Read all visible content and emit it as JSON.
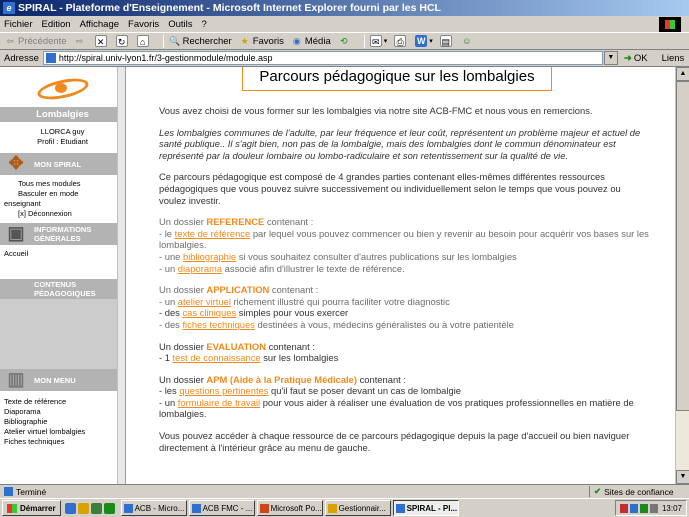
{
  "window": {
    "title": "SPIRAL - Plateforme d'Enseignement - Microsoft Internet Explorer fourni par les HCL"
  },
  "menu": [
    "Fichier",
    "Edition",
    "Affichage",
    "Favoris",
    "Outils",
    "?"
  ],
  "toolbar": {
    "back": "Précédente",
    "search": "Rechercher",
    "favorites": "Favoris",
    "media": "Média"
  },
  "address": {
    "label": "Adresse",
    "url": "http://spiral.univ-lyon1.fr/3-gestionmodule/module.asp",
    "go": "OK",
    "links": "Liens"
  },
  "sidebar": {
    "module_title": "Lombalgies",
    "user_name": "LLORCA guy",
    "user_profile": "Profil : Etudiant",
    "sections": {
      "mon_spiral": "MON SPIRAL",
      "informations": "INFORMATIONS GÉNÉRALES",
      "contenus": "CONTENUS PÉDAGOGIQUES",
      "mon_menu": "MON MENU"
    },
    "mon_spiral_links": [
      "Tous mes modules",
      "Basculer en mode",
      "enseignant",
      "[x] Déconnexion"
    ],
    "info_links": [
      "Accueil"
    ],
    "menu_links": [
      "Texte de référence",
      "Diaporama",
      "Bibliographie",
      "Atelier virtuel lombalgies",
      "Fiches techniques"
    ]
  },
  "page": {
    "heading": "Parcours pédagogique sur les lombalgies",
    "intro": "Vous avez choisi de vous former sur les lombalgies via notre site ACB-FMC et nous vous en remercions.",
    "quote": "Les lombalgies communes de l'adulte, par leur fréquence et leur coût, représentent un problème majeur et actuel de santé publique.. Il s'agit bien, non pas de la lombalgie, mais des lombalgies dont le commun dénominateur est représenté par la douleur lombaire ou lombo-radiculaire et son retentissement sur la qualité de vie.",
    "description": "Ce parcours pédagogique est composé de 4 grandes parties contenant elles-mêmes différentes ressources pédagogiques que vous pouvez suivre successivement ou individuellement selon le temps que vous pouvez ou voulez investir.",
    "reference": {
      "prefix": "Un dossier ",
      "keyword": "REFERENCE",
      "suffix": " contenant :",
      "item1_pre": "- le ",
      "item1_link": "texte de référence",
      "item1_post": " par lequel vous pouvez commencer ou bien y revenir au besoin pour acquérir vos bases sur les lombalgies.",
      "item2_pre": "- une ",
      "item2_link": "bibliographie",
      "item2_post": " si vous souhaitez consulter d'autres publications sur les lombalgies",
      "item3_pre": "- un ",
      "item3_link": "diaporama",
      "item3_post": " associé afin d'illustrer le texte de référence."
    },
    "application": {
      "prefix": "Un dossier ",
      "keyword": "APPLICATION",
      "suffix": " contenant :",
      "item1_pre": "- un ",
      "item1_link": "atelier virtuel",
      "item1_post": " richement illustré qui pourra faciliter votre diagnostic",
      "item2_pre": "- des ",
      "item2_link": "cas cliniques",
      "item2_post": " simples pour vous exercer",
      "item3_pre": "- des ",
      "item3_link": "fiches techniques",
      "item3_post": " destinées à vous, médecins généralistes ou à votre patientèle"
    },
    "evaluation": {
      "prefix": "Un dossier ",
      "keyword": "EVALUATION",
      "suffix": " contenant :",
      "item1_pre": "- 1 ",
      "item1_link": "test de connaissance",
      "item1_post": " sur les lombalgies"
    },
    "apm": {
      "prefix": "Un dossier ",
      "keyword": "APM (Aide à la Pratique Médicale)",
      "suffix": " contenant :",
      "item1_pre": "- les ",
      "item1_link": "questions pertinentes",
      "item1_post": " qu'il faut se poser devant un cas de lombalgie",
      "item2_pre": "- un ",
      "item2_link": "formulaire de travail",
      "item2_post": " pour vous aider à réaliser une évaluation de vos pratiques professionnelles en matière de lombalgies."
    },
    "closing": "Vous pouvez accéder à chaque ressource de ce parcours pédagogique depuis la page d'accueil ou bien naviguer directement à l'intérieur grâce au menu de gauche."
  },
  "status": {
    "left": "Terminé",
    "zone": "Sites de confiance"
  },
  "taskbar": {
    "start": "Démarrer",
    "tasks": [
      "ACB - Micro...",
      "ACB FMC - ...",
      "Microsoft Po...",
      "Gestionnair...",
      "SPIRAL - Pl..."
    ],
    "clock": "13:07"
  },
  "colors": {
    "accent": "#f08a1c",
    "sidebar_gray": "#b3b3b3",
    "titlebar": "#0a246a"
  }
}
